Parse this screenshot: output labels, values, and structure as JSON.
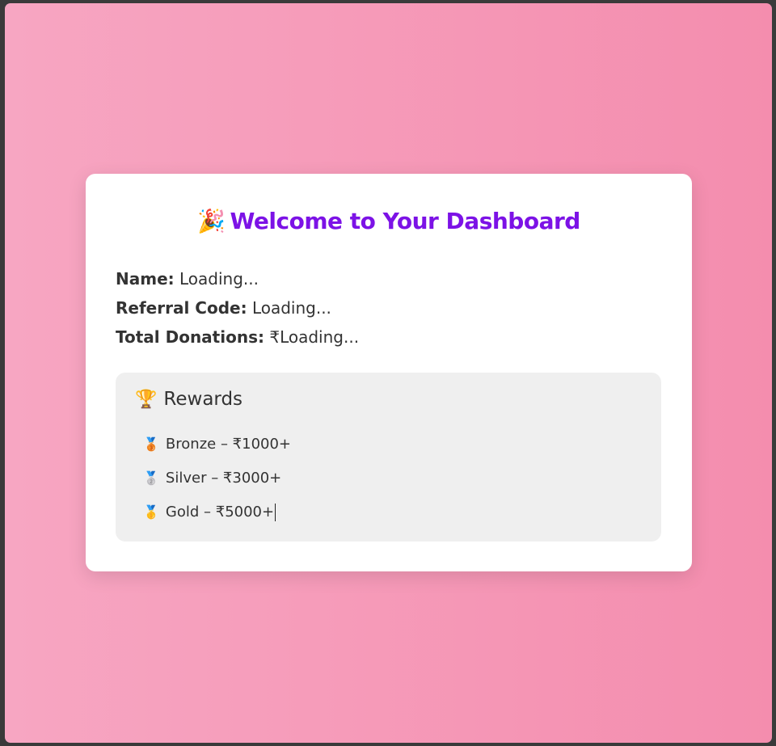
{
  "dashboard": {
    "title_emoji": "🎉",
    "title": "Welcome to Your Dashboard",
    "fields": [
      {
        "label": "Name:",
        "value": "Loading..."
      },
      {
        "label": "Referral Code:",
        "value": "Loading..."
      },
      {
        "label": "Total Donations:",
        "value": "₹Loading..."
      }
    ]
  },
  "rewards": {
    "icon": "🏆",
    "title": "Rewards",
    "items": [
      {
        "icon": "🥉",
        "text": "Bronze – ₹1000+"
      },
      {
        "icon": "🥈",
        "text": "Silver – ₹3000+"
      },
      {
        "icon": "🥇",
        "text": "Gold – ₹5000+"
      }
    ]
  },
  "colors": {
    "title": "#7c12e6",
    "background_start": "#f7a6c2",
    "background_end": "#f48dae",
    "rewards_panel": "#efefef"
  }
}
